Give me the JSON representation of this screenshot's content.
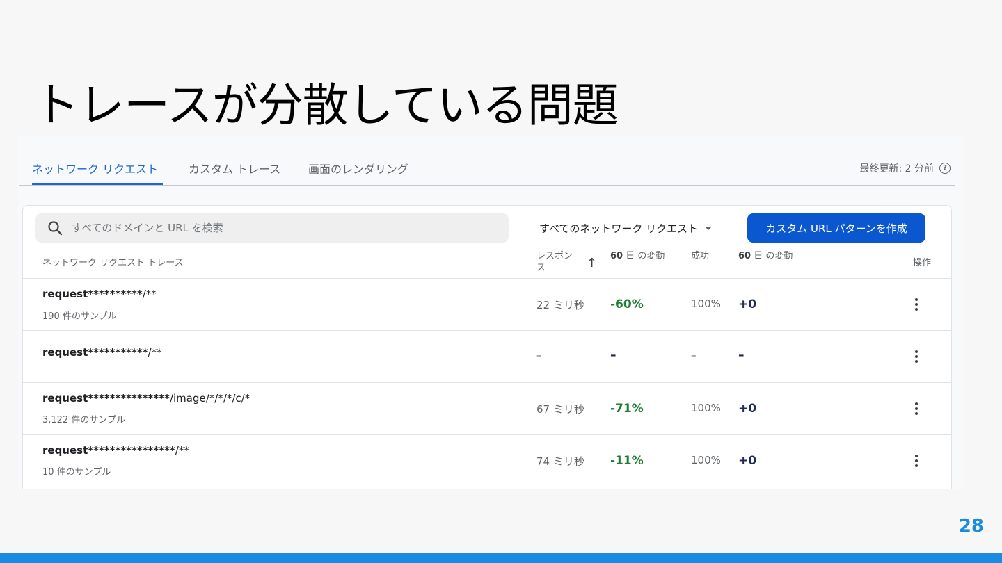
{
  "slide": {
    "title": "トレースが分散している問題",
    "page_number": "28"
  },
  "tabs": [
    {
      "label": "ネットワーク リクエスト",
      "active": true
    },
    {
      "label": "カスタム トレース",
      "active": false
    },
    {
      "label": "画面のレンダリング",
      "active": false
    }
  ],
  "last_updated": "最終更新: 2 分前",
  "search": {
    "placeholder": "すべてのドメインと URL を検索",
    "value": ""
  },
  "filter": {
    "selected": "すべてのネットワーク リクエスト"
  },
  "create_button": "カスタム URL パターンを作成",
  "table": {
    "headers": {
      "name": "ネットワーク リクエスト トレース",
      "response": "レスポンス",
      "change1_bold": "60",
      "change1_rest": " 日 の変動",
      "success": "成功",
      "change2_bold": "60",
      "change2_rest": " 日 の変動",
      "actions": "操作"
    },
    "rows": [
      {
        "name_bold": "request**********",
        "name_rest": "/**",
        "samples": "190 件のサンプル",
        "response": "22 ミリ秒",
        "change": "-60%",
        "success": "100%",
        "change2": "+0"
      },
      {
        "name_bold": "request***********",
        "name_rest": "/**",
        "samples": "",
        "response": "–",
        "change": "–",
        "success": "–",
        "change2": "–"
      },
      {
        "name_bold": "request***************",
        "name_rest": "/image/*/*/*/c/*",
        "samples": "3,122 件のサンプル",
        "response": "67 ミリ秒",
        "change": "-71%",
        "success": "100%",
        "change2": "+0"
      },
      {
        "name_bold": "request****************",
        "name_rest": "/**",
        "samples": "10 件のサンプル",
        "response": "74 ミリ秒",
        "change": "-11%",
        "success": "100%",
        "change2": "+0"
      }
    ]
  },
  "colors": {
    "accent_blue": "#1a66d2",
    "button_blue": "#0b57d0",
    "positive_green": "#1e7d32",
    "slide_bar": "#1a8be0"
  }
}
